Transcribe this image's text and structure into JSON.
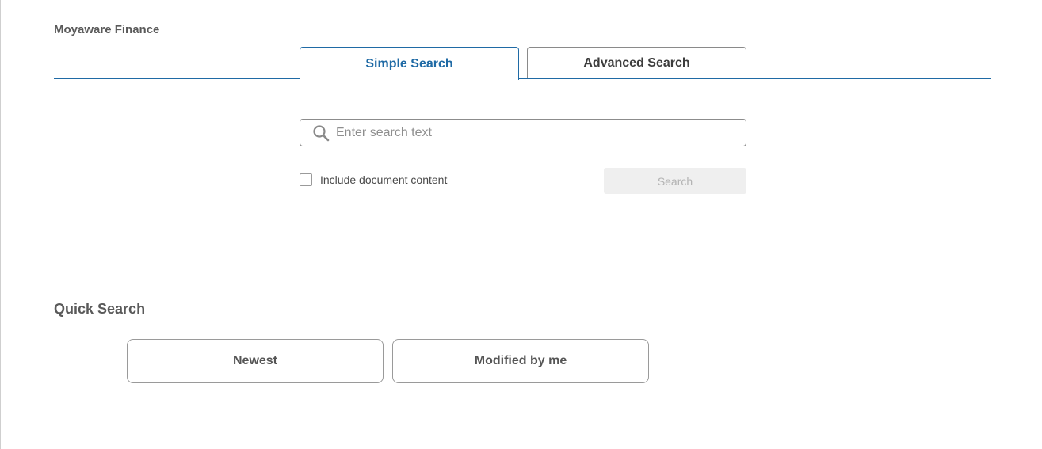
{
  "app": {
    "title": "Moyaware Finance"
  },
  "tabs": [
    {
      "label": "Simple Search",
      "active": true
    },
    {
      "label": "Advanced Search",
      "active": false
    }
  ],
  "search": {
    "placeholder": "Enter search text",
    "value": "",
    "icon": "search-icon",
    "include_content_label": "Include document content",
    "include_content_checked": false,
    "button_label": "Search",
    "button_enabled": false
  },
  "quick_search": {
    "title": "Quick Search",
    "buttons": [
      {
        "label": "Newest"
      },
      {
        "label": "Modified by me"
      }
    ]
  },
  "colors": {
    "accent": "#1f6aa5",
    "text": "#555555",
    "disabled_bg": "#efefef",
    "disabled_text": "#b3b3b3"
  }
}
